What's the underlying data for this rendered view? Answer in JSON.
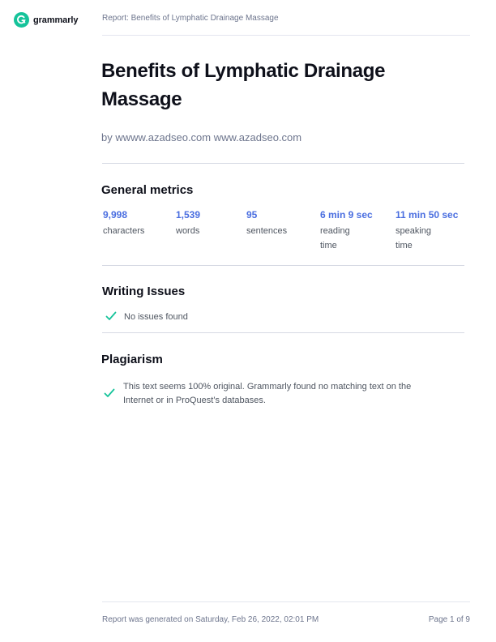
{
  "brand": {
    "name": "grammarly",
    "logo_color": "#15c39a"
  },
  "header": {
    "report_title": "Report: Benefits of Lymphatic Drainage Massage"
  },
  "document": {
    "title": "Benefits of Lymphatic Drainage Massage",
    "author": "by wwww.azadseo.com www.azadseo.com"
  },
  "general_metrics": {
    "heading": "General metrics",
    "items": [
      {
        "value": "9,998",
        "label": "characters"
      },
      {
        "value": "1,539",
        "label": "words"
      },
      {
        "value": "95",
        "label": "sentences"
      },
      {
        "value": "6 min 9 sec",
        "label": "reading time"
      },
      {
        "value": "11 min 50 sec",
        "label": "speaking time"
      }
    ]
  },
  "writing_issues": {
    "heading": "Writing Issues",
    "status_icon": "check-icon",
    "status_text": "No issues found"
  },
  "plagiarism": {
    "heading": "Plagiarism",
    "status_icon": "check-icon",
    "status_text": "This text seems 100% original. Grammarly found no matching text on the Internet or in ProQuest’s databases."
  },
  "footer": {
    "generated": "Report was generated on Saturday, Feb 26, 2022, 02:01 PM",
    "page": "Page 1 of 9"
  },
  "colors": {
    "accent_blue": "#4a6ee0",
    "check_green": "#15c39a"
  }
}
